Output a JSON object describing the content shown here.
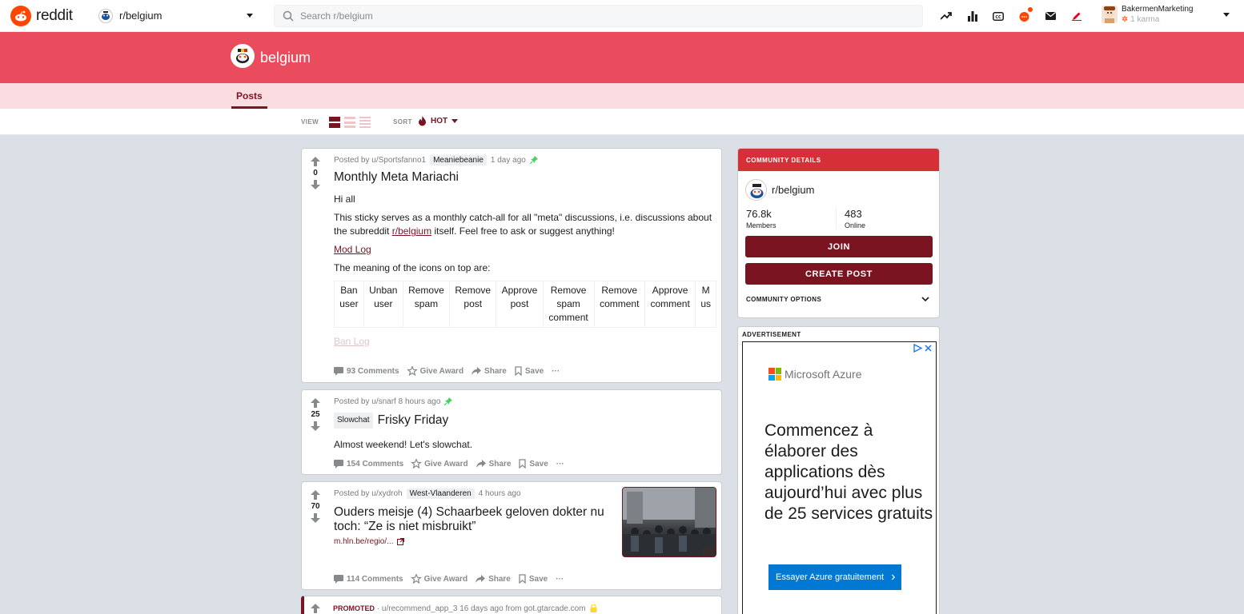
{
  "nav": {
    "logo_text": "reddit",
    "subreddit": "r/belgium",
    "search_placeholder": "Search r/belgium",
    "user": {
      "name": "BakermenMarketing",
      "karma": "1 karma"
    }
  },
  "banner": {
    "title": "belgium"
  },
  "tabs": {
    "posts": "Posts"
  },
  "viewbar": {
    "view_label": "VIEW",
    "sort_label": "SORT",
    "sort_value": "HOT"
  },
  "posts": [
    {
      "votes": "0",
      "posted_by": "Posted by u/Sportsfanno1",
      "flair": "Meaniebeanie",
      "time": "1 day ago",
      "title": "Monthly Meta Mariachi",
      "greeting": "Hi all",
      "para_pre": "This sticky serves as a monthly catch-all for all \"meta\" discussions, i.e. discussions about the subreddit",
      "para_link": "r/belgium",
      "para_post": "itself. Feel free to ask or suggest anything!",
      "mod_log": "Mod Log",
      "icons_intro": "The meaning of the icons on top are:",
      "icon_table": [
        "Ban user",
        "Unban user",
        "Remove spam",
        "Remove post",
        "Approve post",
        "Remove spam comment",
        "Remove comment",
        "Approve comment",
        "M us"
      ],
      "ban_log": "Ban Log",
      "comments": "93 Comments"
    },
    {
      "votes": "25",
      "posted_by": "Posted by u/snarf",
      "time": "8 hours ago",
      "flair": "Slowchat",
      "title": "Frisky Friday",
      "body": "Almost weekend! Let's slowchat.",
      "comments": "154 Comments"
    },
    {
      "votes": "70",
      "posted_by": "Posted by u/xydroh",
      "flair": "West-Vlaanderen",
      "time": "4 hours ago",
      "title": "Ouders meisje (4) Schaarbeek geloven dokter nu toch: “Ze is niet misbruikt”",
      "link": "m.hln.be/regio/...",
      "comments": "114 Comments"
    }
  ],
  "post_actions": {
    "award": "Give Award",
    "share": "Share",
    "save": "Save",
    "more": "···"
  },
  "promoted": {
    "label": "PROMOTED",
    "text": "· u/recommend_app_3 16 days ago from got.gtarcade.com"
  },
  "community": {
    "header": "COMMUNITY DETAILS",
    "name": "r/belgium",
    "members": "76.8k",
    "members_label": "Members",
    "online": "483",
    "online_label": "Online",
    "join": "JOIN",
    "create_post": "CREATE POST",
    "options": "COMMUNITY OPTIONS"
  },
  "ad": {
    "label": "ADVERTISEMENT",
    "brand": "Microsoft Azure",
    "headline": "Commencez à élaborer des applications dès aujourd’hui avec plus de 25 services gratuits",
    "cta": "Essayer Azure gratuitement",
    "cta_arrow": "›"
  },
  "colors": {
    "accent": "#7a1420",
    "banner": "#ea4c5e",
    "header_red": "#d62f37",
    "reddit_orange": "#ff4500"
  }
}
